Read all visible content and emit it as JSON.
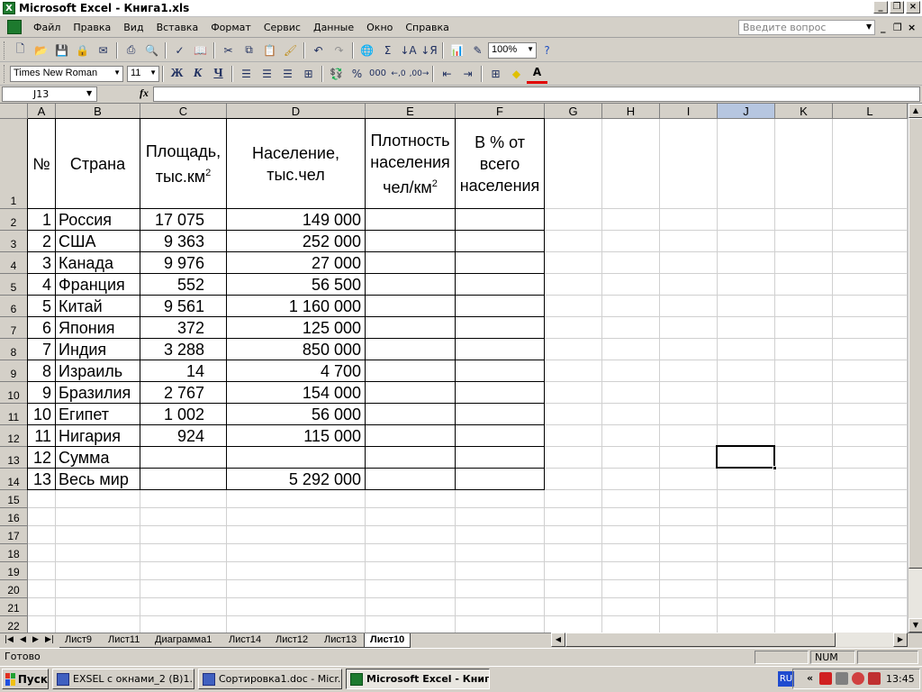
{
  "window": {
    "title": "Microsoft Excel - Книга1.xls"
  },
  "menu": [
    "Файл",
    "Правка",
    "Вид",
    "Вставка",
    "Формат",
    "Сервис",
    "Данные",
    "Окно",
    "Справка"
  ],
  "help_placeholder": "Введите вопрос",
  "toolbar": {
    "zoom": "100%",
    "font_name": "Times New Roman",
    "font_size": "11",
    "bold": "Ж",
    "italic": "К",
    "underline": "Ч",
    "percent": "%",
    "thousands": "000",
    "sigma": "Σ",
    "font_color_letter": "A"
  },
  "formula_bar": {
    "name_box": "J13",
    "fx": "fx",
    "content": ""
  },
  "columns": [
    "A",
    "B",
    "C",
    "D",
    "E",
    "F",
    "G",
    "H",
    "I",
    "J",
    "K",
    "L"
  ],
  "selected_column": "J",
  "rows": [
    "1",
    "2",
    "3",
    "4",
    "5",
    "6",
    "7",
    "8",
    "9",
    "10",
    "11",
    "12",
    "13",
    "14",
    "15",
    "16",
    "17",
    "18",
    "19",
    "20",
    "21",
    "22"
  ],
  "table": {
    "header": {
      "num": "№",
      "country": "Страна",
      "area_line1": "Площадь,",
      "area_line2": "тыс.км",
      "area_sup": "2",
      "pop_line1": "Население,",
      "pop_line2": "тыс.чел",
      "dens_line1": "Плотность",
      "dens_line2": "населения",
      "dens_line3": "чел/км",
      "dens_sup": "2",
      "pct_line1": "В % от",
      "pct_line2": "всего",
      "pct_line3": "населения"
    },
    "rows": [
      {
        "num": "1",
        "country": "Россия",
        "area": "17 075",
        "population": "149 000"
      },
      {
        "num": "2",
        "country": "США",
        "area": "9 363",
        "population": "252 000"
      },
      {
        "num": "3",
        "country": "Канада",
        "area": "9 976",
        "population": "27 000"
      },
      {
        "num": "4",
        "country": "Франция",
        "area": "552",
        "population": "56 500"
      },
      {
        "num": "5",
        "country": "Китай",
        "area": "9 561",
        "population": "1 160 000"
      },
      {
        "num": "6",
        "country": "Япония",
        "area": "372",
        "population": "125 000"
      },
      {
        "num": "7",
        "country": "Индия",
        "area": "3 288",
        "population": "850 000"
      },
      {
        "num": "8",
        "country": "Израиль",
        "area": "14",
        "population": "4 700"
      },
      {
        "num": "9",
        "country": "Бразилия",
        "area": "2 767",
        "population": "154 000"
      },
      {
        "num": "10",
        "country": "Египет",
        "area": "1 002",
        "population": "56 000"
      },
      {
        "num": "11",
        "country": "Нигария",
        "area": "924",
        "population": "115 000"
      },
      {
        "num": "12",
        "country": "Сумма",
        "area": "",
        "population": ""
      },
      {
        "num": "13",
        "country": "Весь мир",
        "area": "",
        "population": "5 292 000"
      }
    ]
  },
  "sheet_tabs": [
    "Лист9",
    "Лист11",
    "Диаграмма1",
    "Лист14",
    "Лист12",
    "Лист13",
    "Лист10"
  ],
  "active_sheet": "Лист10",
  "status": {
    "ready": "Готово",
    "num": "NUM"
  },
  "taskbar": {
    "start": "Пуск",
    "tasks": [
      {
        "label": "EXSEL с окнами_2 (B)1....",
        "active": false
      },
      {
        "label": "Сортировка1.doc - Micr...",
        "active": false
      },
      {
        "label": "Microsoft Excel - Книг...",
        "active": true
      }
    ],
    "lang": "RU",
    "clock": "13:45"
  }
}
